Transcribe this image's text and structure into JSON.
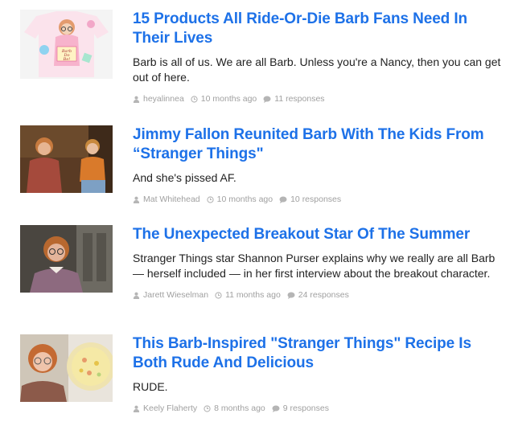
{
  "colors": {
    "link": "#1d71e8",
    "text": "#222222",
    "meta": "#a0a0a0"
  },
  "articles": [
    {
      "title": "15 Products All Ride-Or-Die Barb Fans Need In Their Lives",
      "description": "Barb is all of us. We are all Barb. Unless you're a Nancy, then you can get out of here.",
      "author": "heyalinnea",
      "time": "10 months ago",
      "responses": "11 responses",
      "thumb_text": "Barb Do Be!"
    },
    {
      "title": "Jimmy Fallon Reunited Barb With The Kids From “Stranger Things\"",
      "description": "And she's pissed AF.",
      "author": "Mat Whitehead",
      "time": "10 months ago",
      "responses": "10 responses"
    },
    {
      "title": "The Unexpected Breakout Star Of The Summer",
      "description": "Stranger Things star Shannon Purser explains why we really are all Barb — herself included — in her first interview about the breakout character.",
      "author": "Jarett Wieselman",
      "time": "11 months ago",
      "responses": "24 responses"
    },
    {
      "title": "This Barb-Inspired \"Stranger Things\" Recipe Is Both Rude And Delicious",
      "description": "RUDE.",
      "author": "Keely Flaherty",
      "time": "8 months ago",
      "responses": "9 responses"
    }
  ]
}
